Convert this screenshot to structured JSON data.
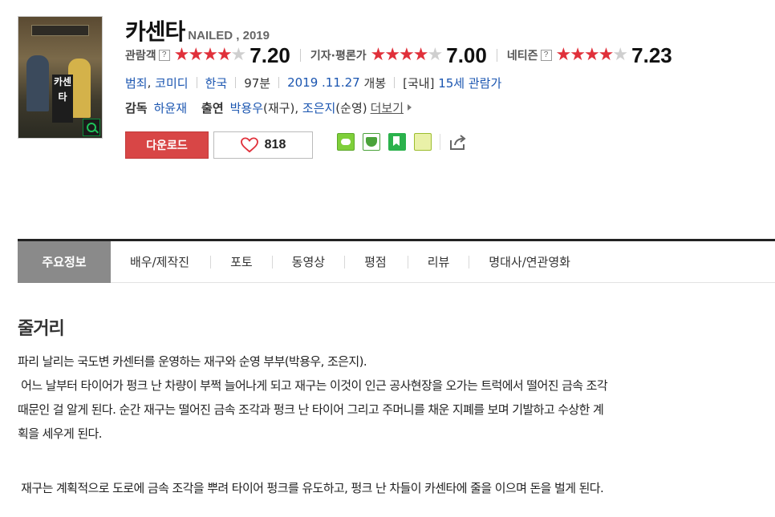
{
  "movie": {
    "title": "카센타",
    "original_title": "NAILED , 2019",
    "poster_text": "카센타"
  },
  "ratings": [
    {
      "label": "관람객",
      "help": "?",
      "score": "7.20",
      "stars_full": 3,
      "stars_half": true
    },
    {
      "label": "기자·평론가",
      "help": "?",
      "score": "7.00",
      "stars_full": 3,
      "stars_half": true
    },
    {
      "label": "네티즌",
      "help": "?",
      "score": "7.23",
      "stars_full": 3,
      "stars_half": true
    }
  ],
  "info": {
    "genre1": "범죄",
    "genre_sep": ",",
    "genre2": "코미디",
    "country": "한국",
    "runtime": "97분",
    "release_date": "2019 .11.27",
    "release_label": "개봉",
    "rating_prefix": "[국내]",
    "rating": "15세 관람가"
  },
  "credits": {
    "director_label": "감독",
    "director": "하윤재",
    "cast_label": "출연",
    "actor1": "박용우",
    "actor1_role": "(재구),",
    "actor2": "조은지",
    "actor2_role": "(순영)",
    "more": "더보기"
  },
  "actions": {
    "download": "다운로드",
    "likes": "818"
  },
  "share_icons": [
    "blog-share-icon",
    "cafe-share-icon",
    "bookmark-share-icon",
    "memo-share-icon",
    "share-icon"
  ],
  "tabs": [
    "주요정보",
    "배우/제작진",
    "포토",
    "동영상",
    "평점",
    "리뷰",
    "명대사/연관영화"
  ],
  "synopsis": {
    "heading": "줄거리",
    "line1": "파리 날리는 국도변 카센터를 운영하는 재구와 순영 부부(박용우, 조은지).",
    "line2": " 어느 날부터 타이어가 펑크 난 차량이 부쩍 늘어나게 되고 재구는 이것이 인근 공사현장을 오가는 트럭에서 떨어진 금속 조각",
    "line3": "때문인 걸 알게 된다. 순간 재구는 떨어진 금속 조각과 펑크 난 타이어 그리고 주머니를 채운 지폐를 보며 기발하고 수상한 계",
    "line4": "획을 세우게 된다.",
    "line5": " 재구는 계획적으로 도로에 금속 조각을 뿌려 타이어 펑크를 유도하고, 펑크 난 차들이 카센타에 줄을 이으며 돈을 벌게 된다."
  },
  "colors": {
    "star_on": "#e0303a",
    "star_off": "#cfcfcf",
    "link": "#1a55b0",
    "download_bg": "#d84646",
    "active_tab_bg": "#8a8a8a"
  }
}
